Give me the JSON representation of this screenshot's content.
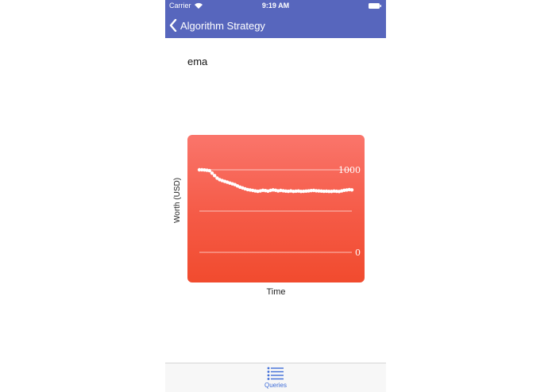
{
  "status_bar": {
    "carrier": "Carrier",
    "time": "9:19 AM"
  },
  "nav": {
    "back_label": "Algorithm Strategy"
  },
  "strategy": {
    "name": "ema"
  },
  "chart_data": {
    "type": "line",
    "title": "",
    "xlabel": "Time",
    "ylabel": "Worth (USD)",
    "y_ticks": [
      "1000",
      "0"
    ],
    "ylim": [
      0,
      1000
    ],
    "grid": true,
    "series": [
      {
        "values": [
          1000,
          1000,
          998,
          995,
          990,
          960,
          930,
          900,
          880,
          870,
          860,
          850,
          840,
          830,
          820,
          805,
          790,
          780,
          770,
          760,
          755,
          750,
          745,
          740,
          745,
          752,
          748,
          742,
          750,
          756,
          752,
          745,
          750,
          746,
          742,
          740,
          744,
          739,
          741,
          743,
          738,
          740,
          742,
          745,
          748,
          750,
          746,
          744,
          742,
          740,
          741,
          739,
          738,
          742,
          740,
          737,
          745,
          752,
          755,
          760,
          757
        ]
      }
    ]
  },
  "tabs": [
    {
      "label": "Queries",
      "icon": "list-icon"
    }
  ],
  "colors": {
    "nav": "#5766bd",
    "chart_top": "#fa756b",
    "chart_bottom": "#f14b2e",
    "tab_active": "#3f6dd8"
  }
}
